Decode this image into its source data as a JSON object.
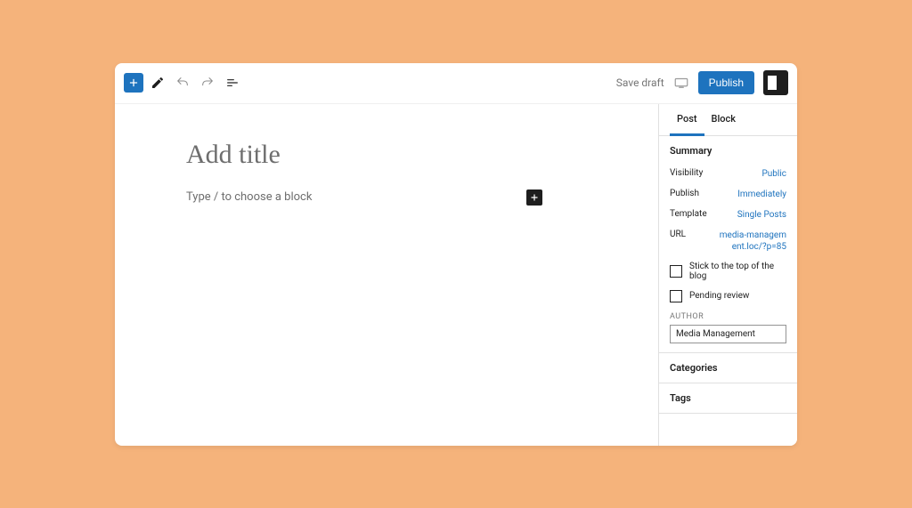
{
  "toolbar": {
    "save_draft": "Save draft",
    "publish_label": "Publish"
  },
  "editor": {
    "title_placeholder": "Add title",
    "block_prompt": "Type / to choose a block"
  },
  "sidebar": {
    "tabs": {
      "post": "Post",
      "block": "Block",
      "active": "post"
    },
    "summary": {
      "title": "Summary",
      "visibility_label": "Visibility",
      "visibility_value": "Public",
      "publish_label": "Publish",
      "publish_value": "Immediately",
      "template_label": "Template",
      "template_value": "Single Posts",
      "url_label": "URL",
      "url_value": "media-management.loc/?p=85",
      "stick_label": "Stick to the top of the blog",
      "pending_label": "Pending review",
      "author_label": "AUTHOR",
      "author_value": "Media Management"
    },
    "sections": {
      "categories": "Categories",
      "tags": "Tags"
    }
  }
}
